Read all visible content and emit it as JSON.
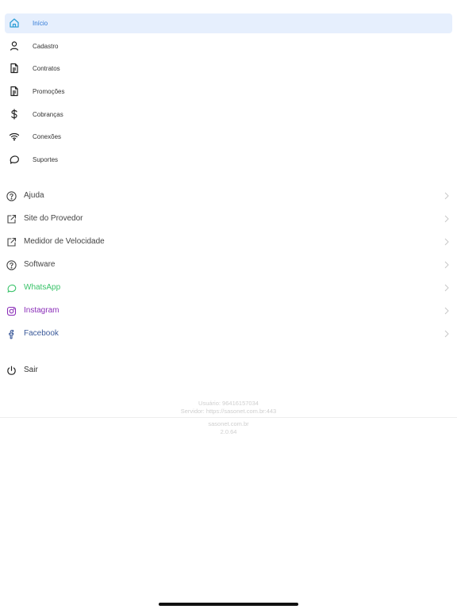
{
  "menu": {
    "items": [
      {
        "label": "Início",
        "icon": "home-icon",
        "active": true
      },
      {
        "label": "Cadastro",
        "icon": "user-icon"
      },
      {
        "label": "Contratos",
        "icon": "document-icon"
      },
      {
        "label": "Promoções",
        "icon": "document-icon"
      },
      {
        "label": "Cobranças",
        "icon": "dollar-icon"
      },
      {
        "label": "Conexões",
        "icon": "wifi-icon"
      },
      {
        "label": "Suportes",
        "icon": "chat-bubble-icon"
      }
    ]
  },
  "links": {
    "items": [
      {
        "label": "Ajuda",
        "icon": "help-circle-icon",
        "color": "#444444"
      },
      {
        "label": "Site do Provedor",
        "icon": "external-link-icon",
        "color": "#444444"
      },
      {
        "label": "Medidor de Velocidade",
        "icon": "external-link-icon",
        "color": "#444444"
      },
      {
        "label": "Software",
        "icon": "help-circle-icon",
        "color": "#444444"
      },
      {
        "label": "WhatsApp",
        "icon": "whatsapp-icon",
        "color": "#3ac36a"
      },
      {
        "label": "Instagram",
        "icon": "instagram-icon",
        "color": "#8a2db8"
      },
      {
        "label": "Facebook",
        "icon": "facebook-icon",
        "color": "#3b5a9a"
      }
    ]
  },
  "logout": {
    "label": "Sair",
    "icon": "power-icon"
  },
  "footer": {
    "user": "Usuário: 96416157034",
    "server": "Servidor: https://sasonet.com.br:443",
    "site": "sasonet.com.br",
    "version": "2.0.64"
  },
  "colors": {
    "accent": "#2f78d6",
    "active_bg": "#e6effd",
    "whatsapp": "#3ac36a",
    "instagram": "#8a2db8",
    "facebook": "#3b5a9a"
  }
}
